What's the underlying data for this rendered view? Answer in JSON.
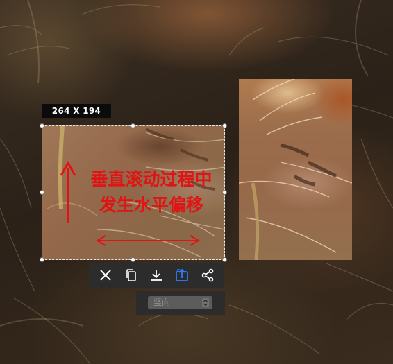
{
  "capture": {
    "size_label": "264 X 194"
  },
  "annotation": {
    "line1": "垂直滚动过程中",
    "line2": "发生水平偏移",
    "color": "#e01414"
  },
  "toolbar": {
    "buttons": [
      {
        "name": "close-button",
        "icon": "close-icon"
      },
      {
        "name": "copy-button",
        "icon": "copy-icon"
      },
      {
        "name": "download-button",
        "icon": "download-icon"
      },
      {
        "name": "scroll-capture-button",
        "icon": "scroll-capture-icon",
        "active": true
      },
      {
        "name": "share-button",
        "icon": "share-icon"
      }
    ],
    "active_color": "#2f7bff"
  },
  "scroll_mode": {
    "selected": "竖向"
  }
}
